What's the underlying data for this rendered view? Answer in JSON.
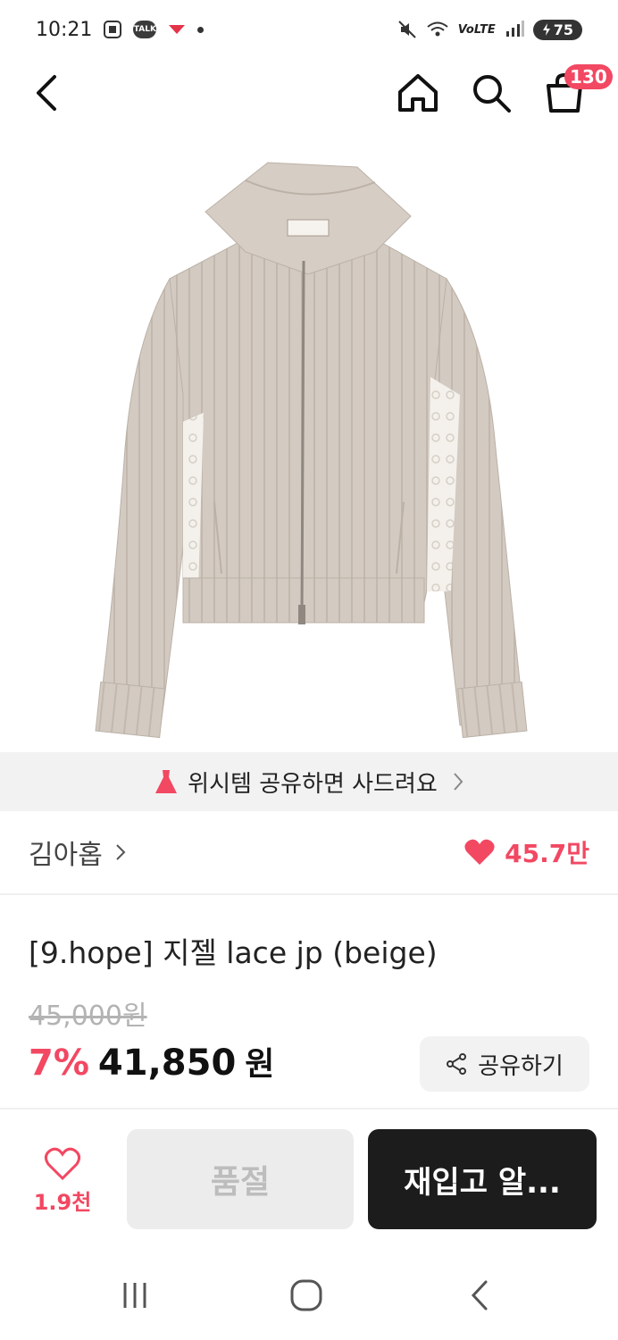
{
  "status_bar": {
    "time": "10:21",
    "talk_badge": "TALK",
    "network": "VoLTE",
    "battery": "75"
  },
  "top_nav": {
    "cart_count": "130"
  },
  "promo_banner": {
    "text": "위시템 공유하면 사드려요"
  },
  "seller": {
    "name": "김아홉",
    "likes": "45.7만"
  },
  "product": {
    "title": "[9.hope] 지젤 lace jp (beige)",
    "original_price": "45,000원",
    "discount": "7%",
    "price": "41,850",
    "currency": "원",
    "share_label": "공유하기"
  },
  "bottom_bar": {
    "wish_count": "1.9천",
    "soldout_label": "품절",
    "restock_label": "재입고 알..."
  },
  "colors": {
    "accent": "#f24862",
    "dark_button": "#1c1c1c",
    "banner_bg": "#f2f2f2"
  },
  "icons": {
    "back": "back-arrow-icon",
    "home": "home-icon",
    "search": "search-icon",
    "cart": "shopping-bag-icon",
    "dress": "dress-icon",
    "heart": "heart-icon",
    "share": "share-icon"
  }
}
